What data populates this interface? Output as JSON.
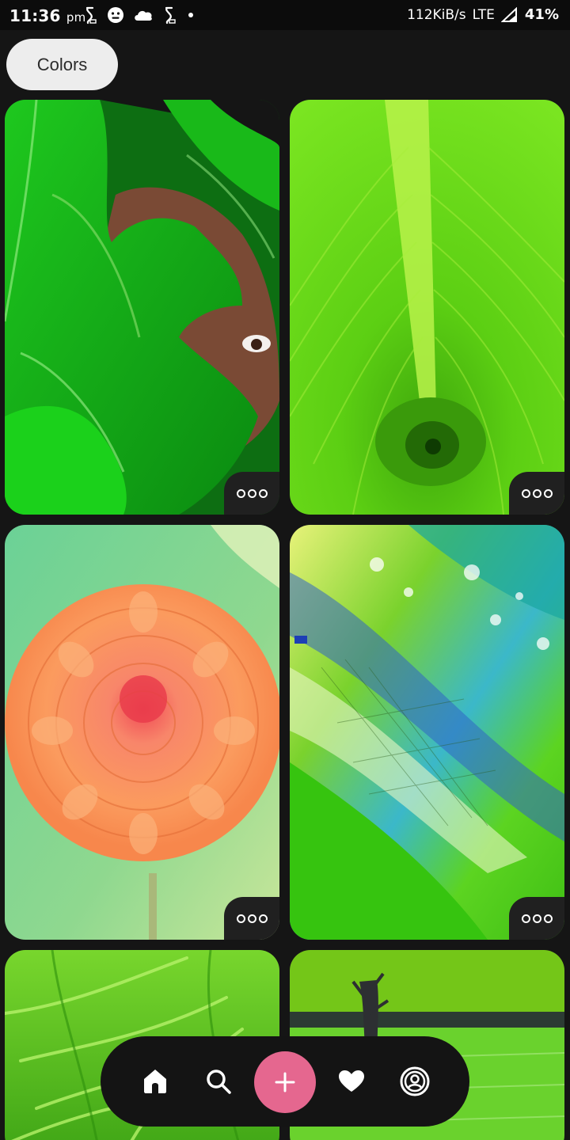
{
  "status_bar": {
    "time": "11:36",
    "am_pm": "pm",
    "network_speed": "112KiB/s",
    "network_type": "LTE",
    "battery": "41%",
    "icons": [
      "s-notification-icon",
      "smiley-icon",
      "cloud-icon",
      "s-notification-icon",
      "dot-icon",
      "signal-icon"
    ]
  },
  "filter": {
    "chip_label": "Colors"
  },
  "feed": {
    "pins": [
      {
        "subject": "woman-behind-leaf",
        "more_icon": "more-dots-icon"
      },
      {
        "subject": "banana-leaf",
        "more_icon": "more-dots-icon"
      },
      {
        "subject": "orange-dahlia",
        "more_icon": "more-dots-icon"
      },
      {
        "subject": "green-abstract-paint",
        "more_icon": "more-dots-icon"
      },
      {
        "subject": "green-grass",
        "more_icon": "more-dots-icon"
      },
      {
        "subject": "green-field",
        "more_icon": "more-dots-icon"
      }
    ]
  },
  "bottom_nav": {
    "items": [
      "home-icon",
      "search-icon",
      "plus-icon",
      "heart-icon",
      "profile-icon"
    ],
    "create_color": "#e5678f"
  },
  "colors": {
    "background": "#151515",
    "chip": "#ededed",
    "accent": "#e5678f"
  }
}
